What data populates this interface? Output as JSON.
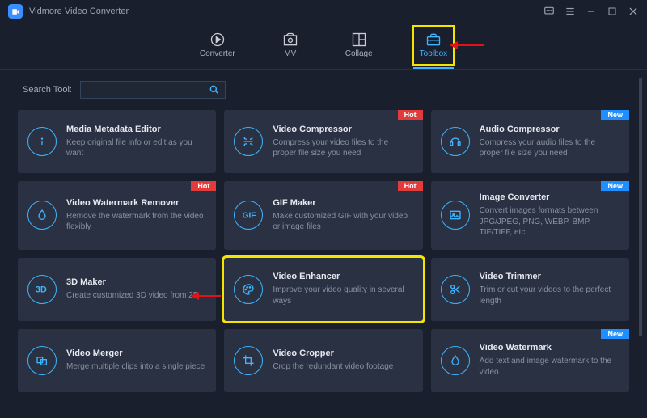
{
  "app": {
    "title": "Vidmore Video Converter"
  },
  "nav": {
    "tabs": [
      {
        "id": "converter",
        "label": "Converter"
      },
      {
        "id": "mv",
        "label": "MV"
      },
      {
        "id": "collage",
        "label": "Collage"
      },
      {
        "id": "toolbox",
        "label": "Toolbox",
        "active": true,
        "highlight": true
      }
    ]
  },
  "search": {
    "label": "Search Tool:",
    "value": ""
  },
  "badges": {
    "hot": "Hot",
    "new": "New"
  },
  "tools": [
    {
      "id": "media-metadata-editor",
      "icon": "info",
      "title": "Media Metadata Editor",
      "desc": "Keep original file info or edit as you want"
    },
    {
      "id": "video-compressor",
      "icon": "compress",
      "title": "Video Compressor",
      "desc": "Compress your video files to the proper file size you need",
      "badge": "hot"
    },
    {
      "id": "audio-compressor",
      "icon": "audio",
      "title": "Audio Compressor",
      "desc": "Compress your audio files to the proper file size you need",
      "badge": "new"
    },
    {
      "id": "video-watermark-remover",
      "icon": "drop",
      "title": "Video Watermark Remover",
      "desc": "Remove the watermark from the video flexibly",
      "badge": "hot"
    },
    {
      "id": "gif-maker",
      "icon": "gif",
      "title": "GIF Maker",
      "desc": "Make customized GIF with your video or image files",
      "badge": "hot"
    },
    {
      "id": "image-converter",
      "icon": "image",
      "title": "Image Converter",
      "desc": "Convert images formats between JPG/JPEG, PNG, WEBP, BMP, TIF/TIFF, etc.",
      "badge": "new"
    },
    {
      "id": "3d-maker",
      "icon": "3d",
      "title": "3D Maker",
      "desc": "Create customized 3D video from 2D"
    },
    {
      "id": "video-enhancer",
      "icon": "palette",
      "title": "Video Enhancer",
      "desc": "Improve your video quality in several ways",
      "highlight": true
    },
    {
      "id": "video-trimmer",
      "icon": "scissors",
      "title": "Video Trimmer",
      "desc": "Trim or cut your videos to the perfect length"
    },
    {
      "id": "video-merger",
      "icon": "merge",
      "title": "Video Merger",
      "desc": "Merge multiple clips into a single piece"
    },
    {
      "id": "video-cropper",
      "icon": "crop",
      "title": "Video Cropper",
      "desc": "Crop the redundant video footage"
    },
    {
      "id": "video-watermark",
      "icon": "drop",
      "title": "Video Watermark",
      "desc": "Add text and image watermark to the video",
      "badge": "new"
    }
  ]
}
